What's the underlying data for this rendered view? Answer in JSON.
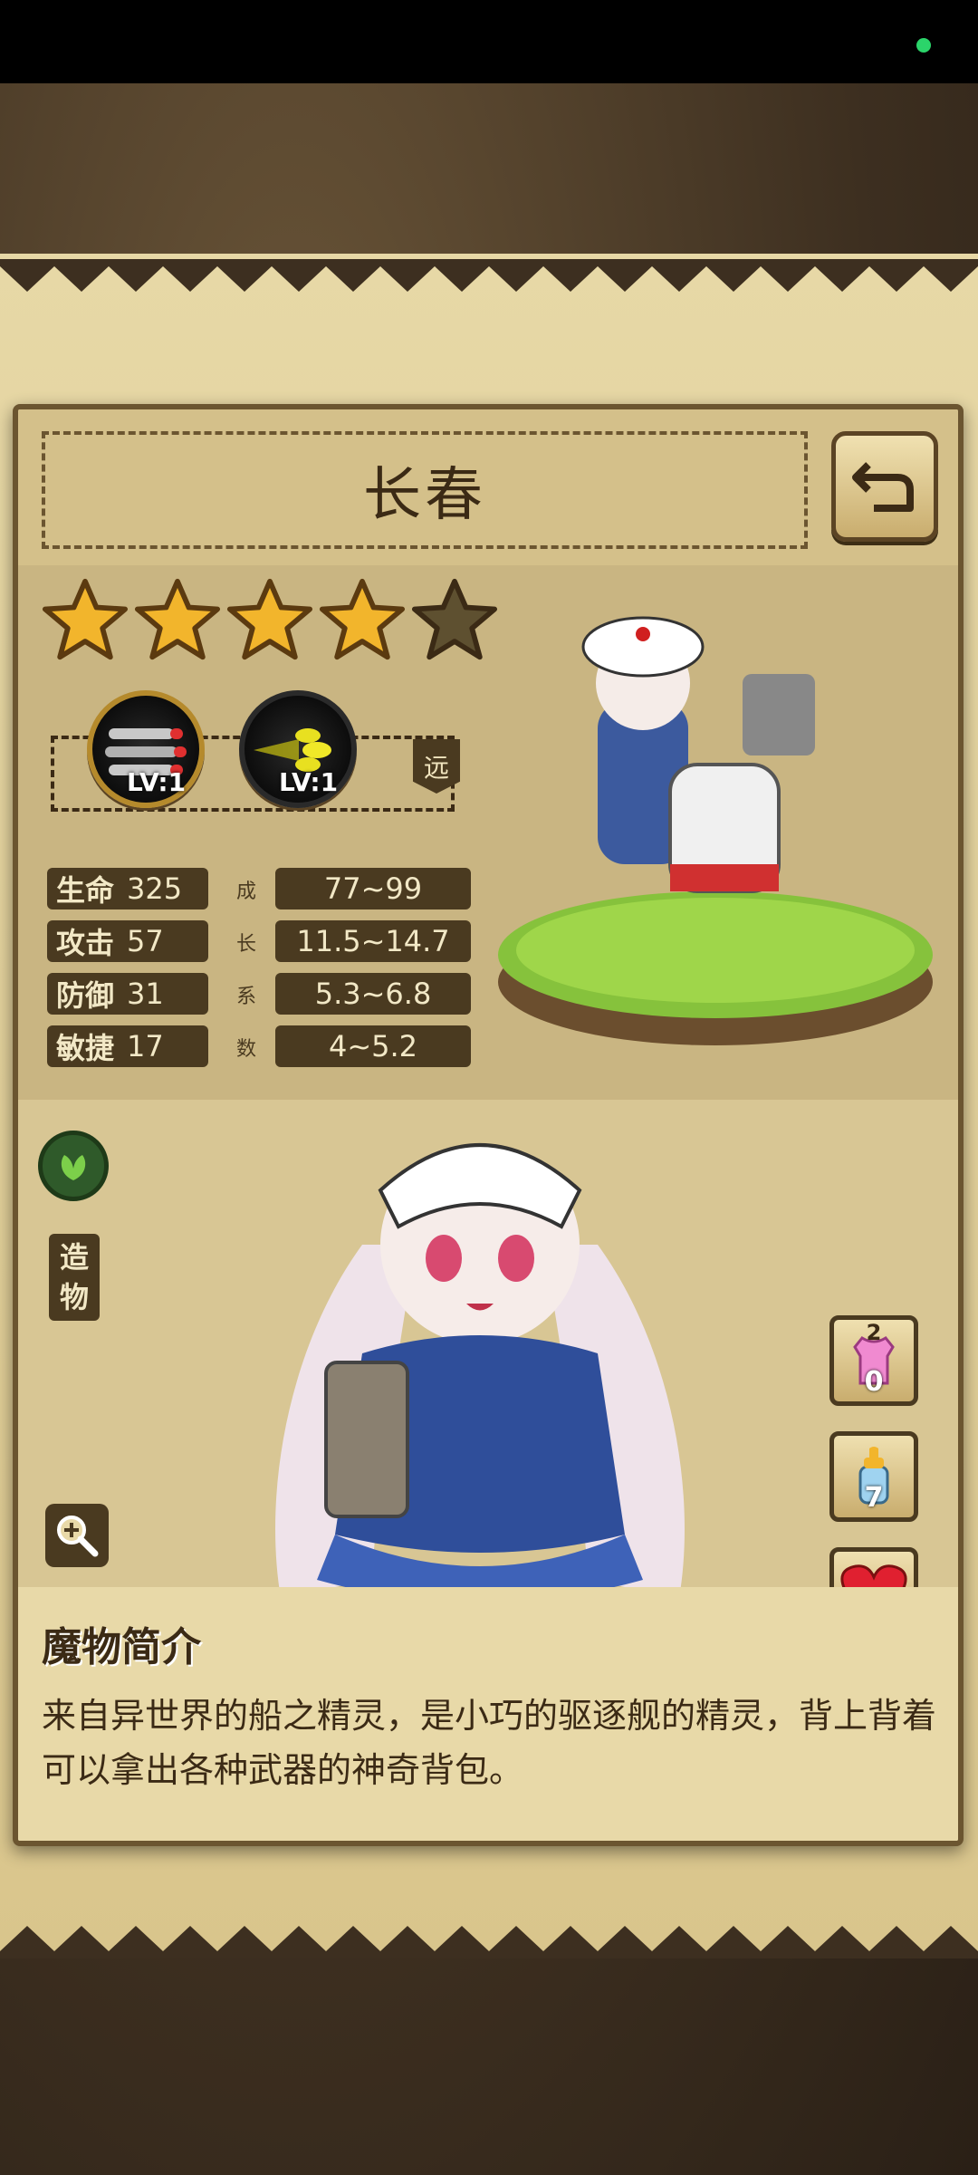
{
  "character": {
    "name": "长春",
    "stars_filled": 4,
    "stars_total": 5,
    "range_tag": "远",
    "skills": [
      {
        "level": "LV:1",
        "icon": "torpedo-skill-icon"
      },
      {
        "level": "LV:1",
        "icon": "energy-blast-skill-icon"
      }
    ]
  },
  "stats": [
    {
      "name": "生命",
      "value": "325",
      "growth": "77~99"
    },
    {
      "name": "攻击",
      "value": "57",
      "growth": "11.5~14.7"
    },
    {
      "name": "防御",
      "value": "31",
      "growth": "5.3~6.8"
    },
    {
      "name": "敏捷",
      "value": "17",
      "growth": "4~5.2"
    }
  ],
  "growth_label": [
    "成",
    "长",
    "系",
    "数"
  ],
  "side_left": {
    "element_icon": "leaf-element-icon",
    "category": [
      "造",
      "物"
    ],
    "zoom_icon": "zoom-in-icon"
  },
  "side_right": {
    "outfit_badge": "2",
    "outfit_count": "0",
    "bottle_count": "7"
  },
  "description": {
    "title": "魔物简介",
    "text": "来自异世界的船之精灵，是小巧的驱逐舰的精灵，背上背着可以拿出各种武器的神奇背包。"
  },
  "colors": {
    "card_bg": "#e8d9a8",
    "dark_brown": "#4a3a20",
    "gold": "#f2b52c",
    "heart": "#e02030"
  }
}
